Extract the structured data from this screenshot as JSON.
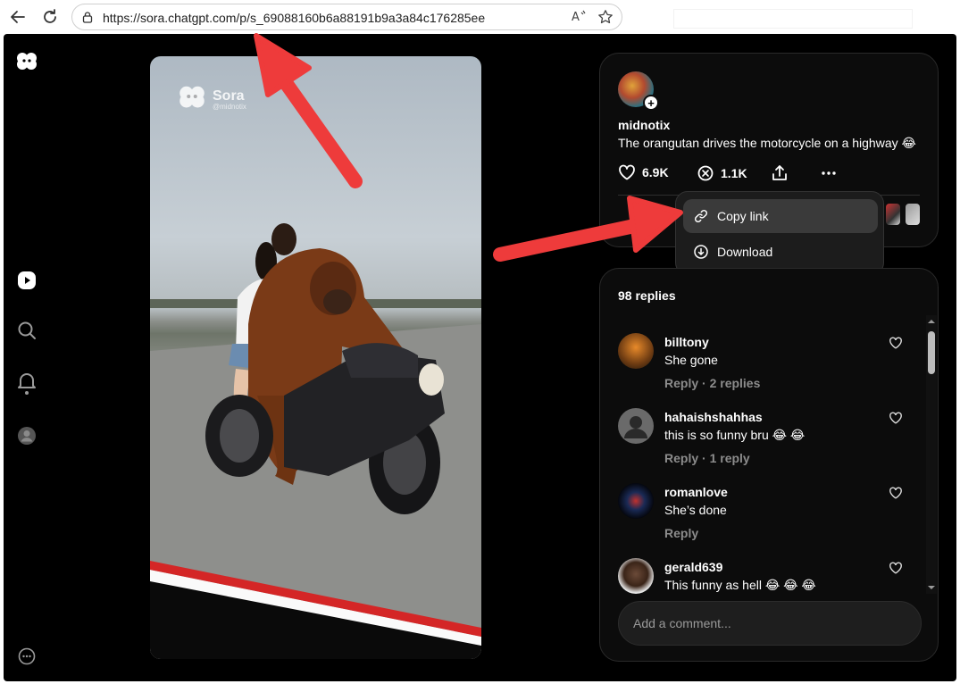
{
  "browser": {
    "url": "https://sora.chatgpt.com/p/s_69088160b6a88191b9a3a84c176285ee",
    "back_icon": "back-arrow-icon",
    "refresh_icon": "refresh-icon",
    "lock_icon": "lock-icon",
    "read_aloud_icon": "read-aloud-icon",
    "favorite_icon": "star-icon"
  },
  "sidebar": {
    "logo_icon": "sora-logo-icon",
    "items": [
      {
        "icon": "play-icon",
        "label": "Feed"
      },
      {
        "icon": "search-icon",
        "label": "Search"
      },
      {
        "icon": "bell-icon",
        "label": "Notifications"
      },
      {
        "icon": "profile-icon",
        "label": "Profile"
      }
    ],
    "more_icon": "more-circle-icon"
  },
  "video": {
    "watermark_brand": "Sora",
    "watermark_handle": "@midnotix"
  },
  "post": {
    "username": "midnotix",
    "caption": "The orangutan drives the motorcycle on a highway 😂",
    "likes": "6.9K",
    "remixes": "1.1K"
  },
  "menu": {
    "items": [
      {
        "label": "Copy link",
        "icon": "link-icon"
      },
      {
        "label": "Download",
        "icon": "download-icon"
      }
    ]
  },
  "replies": {
    "title": "98 replies",
    "items": [
      {
        "name": "billtony",
        "text": "She gone",
        "meta": "Reply · 2 replies"
      },
      {
        "name": "hahaishshahhas",
        "text": "this is so funny bru 😂 😂",
        "meta": "Reply · 1 reply"
      },
      {
        "name": "romanlove",
        "text": "She’s done",
        "meta": "Reply"
      },
      {
        "name": "gerald639",
        "text": "This funny as hell 😂 😂 😂",
        "meta": ""
      }
    ],
    "comment_placeholder": "Add a comment..."
  },
  "colors": {
    "background": "#000000",
    "card": "#0c0c0c",
    "annotation_arrow": "#ee3b3b"
  }
}
